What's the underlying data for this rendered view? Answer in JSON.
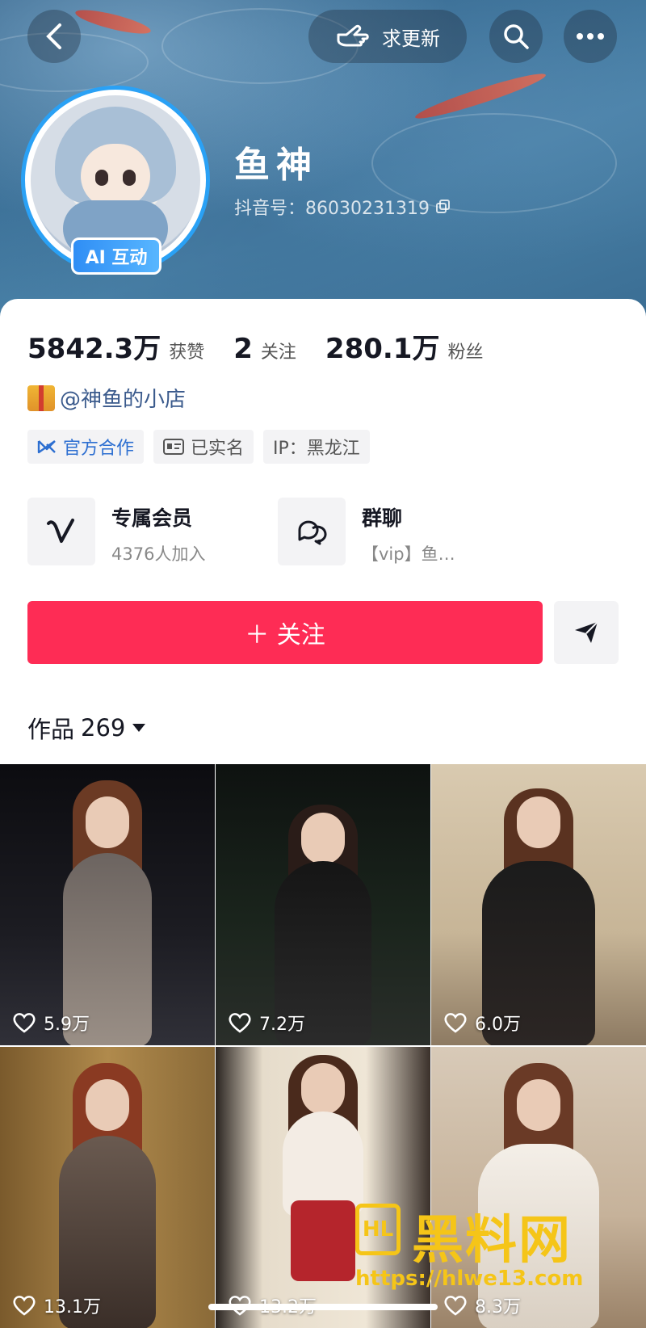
{
  "header": {
    "request_update_label": "求更新",
    "name": "鱼神",
    "douyin_id": "抖音号：86030231319",
    "ai_badge": "AI 互动"
  },
  "stats": [
    {
      "value": "5842.3万",
      "label": "获赞"
    },
    {
      "value": "2",
      "label": "关注"
    },
    {
      "value": "280.1万",
      "label": "粉丝"
    }
  ],
  "shop_link": "@神鱼的小店",
  "tags": {
    "official": "官方合作",
    "verified": "已实名",
    "ip": "IP：黑龙江"
  },
  "services": [
    {
      "title": "专属会员",
      "subtitle": "4376人加入"
    },
    {
      "title": "群聊",
      "subtitle": "【vip】鱼…"
    }
  ],
  "follow_label": "＋ 关注",
  "works": {
    "label": "作品",
    "count": "269"
  },
  "videos": [
    {
      "likes": "5.9万"
    },
    {
      "likes": "7.2万"
    },
    {
      "likes": "6.0万"
    },
    {
      "likes": "13.1万"
    },
    {
      "likes": "13.2万"
    },
    {
      "likes": "8.3万"
    }
  ],
  "watermark": {
    "logo": "HL",
    "title": "黑料网",
    "url": "https://hlwe13.com"
  },
  "colors": {
    "accent": "#fe2c55",
    "avatar_ring": "#2aa1f5",
    "link": "#3a5a8c"
  }
}
